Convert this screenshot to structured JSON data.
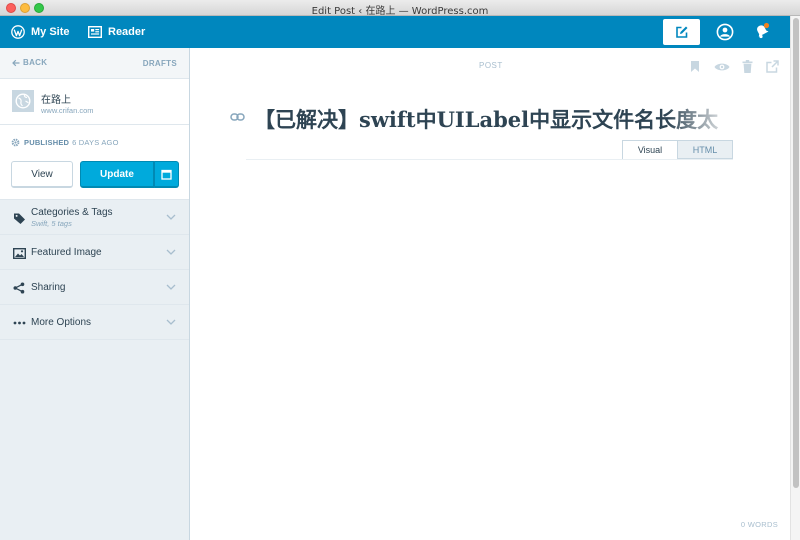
{
  "window": {
    "title": "Edit Post ‹ 在路上 — WordPress.com"
  },
  "masterbar": {
    "my_site": "My Site",
    "reader": "Reader"
  },
  "sidebar": {
    "back": "BACK",
    "drafts": "DRAFTS",
    "site": {
      "name": "在路上",
      "url": "www.crifan.com"
    },
    "status": {
      "label": "PUBLISHED",
      "when": "6 DAYS AGO"
    },
    "view_button": "View",
    "update_button": "Update",
    "sections": [
      {
        "title": "Categories & Tags",
        "subtitle": "Swift, 5 tags",
        "icon": "tag-icon"
      },
      {
        "title": "Featured Image",
        "subtitle": "",
        "icon": "image-icon"
      },
      {
        "title": "Sharing",
        "subtitle": "",
        "icon": "share-icon"
      },
      {
        "title": "More Options",
        "subtitle": "",
        "icon": "ellipsis-icon"
      }
    ]
  },
  "editor": {
    "post_type": "POST",
    "title": "【已解决】swift中UILabel中显示文件名长度太",
    "modes": {
      "visual": "Visual",
      "html": "HTML"
    },
    "word_count": "0 WORDS"
  },
  "colors": {
    "masterbar": "#0087be",
    "primary": "#00aadc",
    "sidebar": "#e9eff3",
    "text": "#2e4453",
    "muted": "#87a6bc"
  }
}
